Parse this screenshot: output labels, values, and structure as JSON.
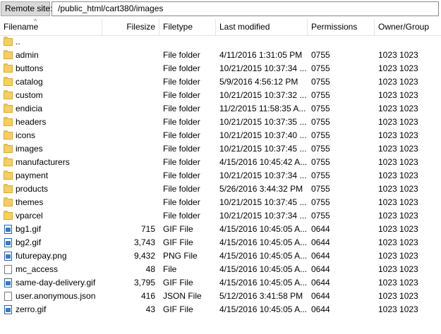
{
  "remote": {
    "label": "Remote site:",
    "path": "/public_html/cart380/images"
  },
  "columns": {
    "filename": "Filename",
    "filesize": "Filesize",
    "filetype": "Filetype",
    "modified": "Last modified",
    "permissions": "Permissions",
    "owner": "Owner/Group"
  },
  "sort": {
    "column": "filename",
    "direction": "ascending"
  },
  "rows": [
    {
      "icon": "folder-icon",
      "name": "..",
      "size": "",
      "type": "",
      "modified": "",
      "perm": "",
      "owner": ""
    },
    {
      "icon": "folder-icon",
      "name": "admin",
      "size": "",
      "type": "File folder",
      "modified": "4/11/2016 1:31:05 PM",
      "perm": "0755",
      "owner": "1023 1023"
    },
    {
      "icon": "folder-icon",
      "name": "buttons",
      "size": "",
      "type": "File folder",
      "modified": "10/21/2015 10:37:34 ...",
      "perm": "0755",
      "owner": "1023 1023"
    },
    {
      "icon": "folder-icon",
      "name": "catalog",
      "size": "",
      "type": "File folder",
      "modified": "5/9/2016 4:56:12 PM",
      "perm": "0755",
      "owner": "1023 1023"
    },
    {
      "icon": "folder-icon",
      "name": "custom",
      "size": "",
      "type": "File folder",
      "modified": "10/21/2015 10:37:32 ...",
      "perm": "0755",
      "owner": "1023 1023"
    },
    {
      "icon": "folder-icon",
      "name": "endicia",
      "size": "",
      "type": "File folder",
      "modified": "11/2/2015 11:58:35 A...",
      "perm": "0755",
      "owner": "1023 1023"
    },
    {
      "icon": "folder-icon",
      "name": "headers",
      "size": "",
      "type": "File folder",
      "modified": "10/21/2015 10:37:35 ...",
      "perm": "0755",
      "owner": "1023 1023"
    },
    {
      "icon": "folder-icon",
      "name": "icons",
      "size": "",
      "type": "File folder",
      "modified": "10/21/2015 10:37:40 ...",
      "perm": "0755",
      "owner": "1023 1023"
    },
    {
      "icon": "folder-icon",
      "name": "images",
      "size": "",
      "type": "File folder",
      "modified": "10/21/2015 10:37:45 ...",
      "perm": "0755",
      "owner": "1023 1023"
    },
    {
      "icon": "folder-icon",
      "name": "manufacturers",
      "size": "",
      "type": "File folder",
      "modified": "4/15/2016 10:45:42 A...",
      "perm": "0755",
      "owner": "1023 1023"
    },
    {
      "icon": "folder-icon",
      "name": "payment",
      "size": "",
      "type": "File folder",
      "modified": "10/21/2015 10:37:34 ...",
      "perm": "0755",
      "owner": "1023 1023"
    },
    {
      "icon": "folder-icon",
      "name": "products",
      "size": "",
      "type": "File folder",
      "modified": "5/26/2016 3:44:32 PM",
      "perm": "0755",
      "owner": "1023 1023"
    },
    {
      "icon": "folder-icon",
      "name": "themes",
      "size": "",
      "type": "File folder",
      "modified": "10/21/2015 10:37:45 ...",
      "perm": "0755",
      "owner": "1023 1023"
    },
    {
      "icon": "folder-icon",
      "name": "vparcel",
      "size": "",
      "type": "File folder",
      "modified": "10/21/2015 10:37:34 ...",
      "perm": "0755",
      "owner": "1023 1023"
    },
    {
      "icon": "image-file-icon",
      "name": "bg1.gif",
      "size": "715",
      "type": "GIF File",
      "modified": "4/15/2016 10:45:05 A...",
      "perm": "0644",
      "owner": "1023 1023"
    },
    {
      "icon": "image-file-icon",
      "name": "bg2.gif",
      "size": "3,743",
      "type": "GIF File",
      "modified": "4/15/2016 10:45:05 A...",
      "perm": "0644",
      "owner": "1023 1023"
    },
    {
      "icon": "image-file-icon",
      "name": "futurepay.png",
      "size": "9,432",
      "type": "PNG File",
      "modified": "4/15/2016 10:45:05 A...",
      "perm": "0644",
      "owner": "1023 1023"
    },
    {
      "icon": "file-icon",
      "name": "mc_access",
      "size": "48",
      "type": "File",
      "modified": "4/15/2016 10:45:05 A...",
      "perm": "0644",
      "owner": "1023 1023"
    },
    {
      "icon": "image-file-icon",
      "name": "same-day-delivery.gif",
      "size": "3,795",
      "type": "GIF File",
      "modified": "4/15/2016 10:45:05 A...",
      "perm": "0644",
      "owner": "1023 1023"
    },
    {
      "icon": "file-icon",
      "name": "user.anonymous.json",
      "size": "416",
      "type": "JSON File",
      "modified": "5/12/2016 3:41:58 PM",
      "perm": "0644",
      "owner": "1023 1023"
    },
    {
      "icon": "image-file-icon",
      "name": "zerro.gif",
      "size": "43",
      "type": "GIF File",
      "modified": "4/15/2016 10:45:05 A...",
      "perm": "0644",
      "owner": "1023 1023"
    }
  ]
}
